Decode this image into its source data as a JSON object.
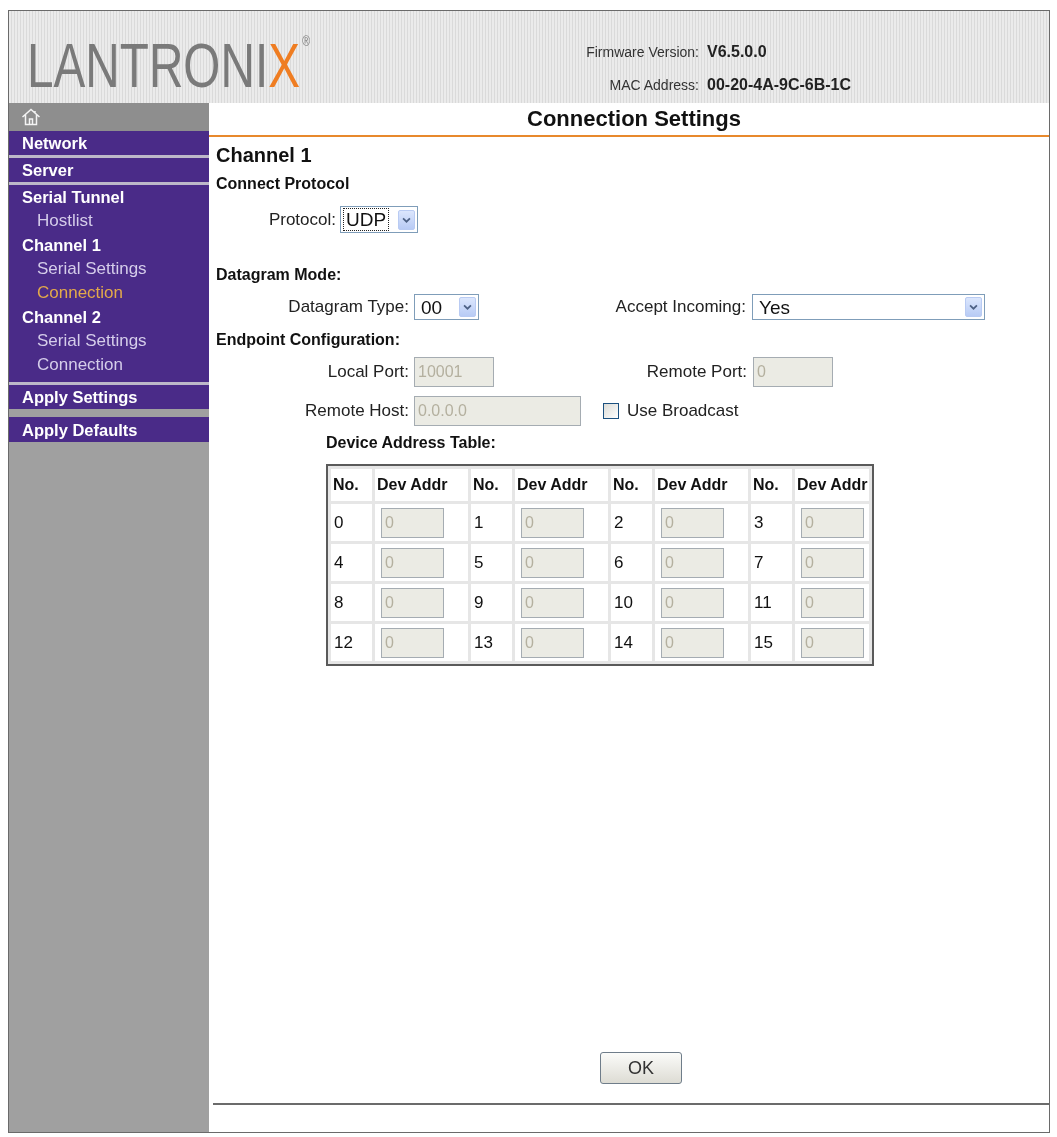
{
  "header": {
    "logo": {
      "text": "LANTRONI",
      "accent": "X",
      "mark": "®"
    },
    "info": [
      {
        "label": "Firmware Version:",
        "value": "V6.5.0.0"
      },
      {
        "label": "MAC Address:",
        "value": "00-20-4A-9C-6B-1C"
      }
    ]
  },
  "sidebar": {
    "sections": [
      {
        "items": [
          {
            "label": "Network",
            "selected": false
          }
        ]
      },
      {
        "items": [
          {
            "label": "Server",
            "selected": false
          }
        ]
      },
      {
        "items": [
          {
            "label": "Serial Tunnel",
            "selected": false,
            "children": [
              {
                "label": "Hostlist",
                "selected": false
              }
            ]
          },
          {
            "label": "Channel 1",
            "selected": false,
            "children": [
              {
                "label": "Serial Settings",
                "selected": false
              },
              {
                "label": "Connection",
                "selected": true
              }
            ]
          },
          {
            "label": "Channel 2",
            "selected": false,
            "children": [
              {
                "label": "Serial Settings",
                "selected": false
              },
              {
                "label": "Connection",
                "selected": false
              }
            ]
          }
        ]
      }
    ],
    "actions": [
      {
        "label": "Apply Settings"
      },
      {
        "label": "Apply Defaults"
      }
    ]
  },
  "content": {
    "title": "Connection Settings",
    "channel": "Channel 1",
    "connect_protocol": {
      "heading": "Connect Protocol",
      "protocol": {
        "label": "Protocol:",
        "value": "UDP",
        "focused": true
      }
    },
    "datagram_mode": {
      "heading": "Datagram Mode:",
      "datagram_type": {
        "label": "Datagram Type:",
        "value": "00",
        "focused": false
      },
      "accept_incoming": {
        "label": "Accept Incoming:",
        "value": "Yes",
        "focused": false
      }
    },
    "endpoint": {
      "heading": "Endpoint Configuration:",
      "local_port": {
        "label": "Local Port:",
        "value": "10001",
        "disabled": true
      },
      "remote_port": {
        "label": "Remote Port:",
        "value": "0",
        "disabled": true
      },
      "remote_host": {
        "label": "Remote Host:",
        "value": "0.0.0.0",
        "disabled": true
      },
      "use_broadcast": {
        "label": "Use Broadcast",
        "checked": false
      }
    },
    "device_address_table": {
      "title": "Device Address Table:",
      "columns": [
        "No.",
        "Dev Addr",
        "No.",
        "Dev Addr",
        "No.",
        "Dev Addr",
        "No.",
        "Dev Addr"
      ],
      "rows": [
        [
          {
            "kind": "number",
            "text": "0"
          },
          {
            "kind": "field",
            "value": "0",
            "disabled": true
          },
          {
            "kind": "number",
            "text": "1"
          },
          {
            "kind": "field",
            "value": "0",
            "disabled": true
          },
          {
            "kind": "number",
            "text": "2"
          },
          {
            "kind": "field",
            "value": "0",
            "disabled": true
          },
          {
            "kind": "number",
            "text": "3"
          },
          {
            "kind": "field",
            "value": "0",
            "disabled": true
          }
        ],
        [
          {
            "kind": "number",
            "text": "4"
          },
          {
            "kind": "field",
            "value": "0",
            "disabled": true
          },
          {
            "kind": "number",
            "text": "5"
          },
          {
            "kind": "field",
            "value": "0",
            "disabled": true
          },
          {
            "kind": "number",
            "text": "6"
          },
          {
            "kind": "field",
            "value": "0",
            "disabled": true
          },
          {
            "kind": "number",
            "text": "7"
          },
          {
            "kind": "field",
            "value": "0",
            "disabled": true
          }
        ],
        [
          {
            "kind": "number",
            "text": "8"
          },
          {
            "kind": "field",
            "value": "0",
            "disabled": true
          },
          {
            "kind": "number",
            "text": "9"
          },
          {
            "kind": "field",
            "value": "0",
            "disabled": true
          },
          {
            "kind": "number",
            "text": "10"
          },
          {
            "kind": "field",
            "value": "0",
            "disabled": true
          },
          {
            "kind": "number",
            "text": "11"
          },
          {
            "kind": "field",
            "value": "0",
            "disabled": true
          }
        ],
        [
          {
            "kind": "number",
            "text": "12"
          },
          {
            "kind": "field",
            "value": "0",
            "disabled": true
          },
          {
            "kind": "number",
            "text": "13"
          },
          {
            "kind": "field",
            "value": "0",
            "disabled": true
          },
          {
            "kind": "number",
            "text": "14"
          },
          {
            "kind": "field",
            "value": "0",
            "disabled": true
          },
          {
            "kind": "number",
            "text": "15"
          },
          {
            "kind": "field",
            "value": "0",
            "disabled": true
          }
        ]
      ]
    },
    "ok_button": "OK"
  }
}
